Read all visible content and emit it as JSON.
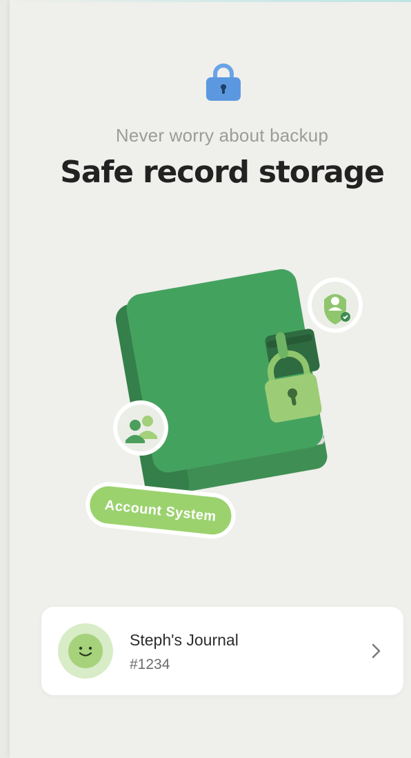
{
  "header": {
    "subtitle": "Never worry about backup",
    "title": "Safe record storage"
  },
  "illustration": {
    "badge_label": "Account System"
  },
  "account": {
    "name": "Steph's Journal",
    "id": "#1234"
  },
  "icons": {
    "header": "lock-icon",
    "row_action": "chevron-right-icon"
  },
  "colors": {
    "background": "#efefeb",
    "lock_blue": "#5b98e0",
    "book_green": "#44a25f",
    "badge_green": "#9bd26e"
  }
}
